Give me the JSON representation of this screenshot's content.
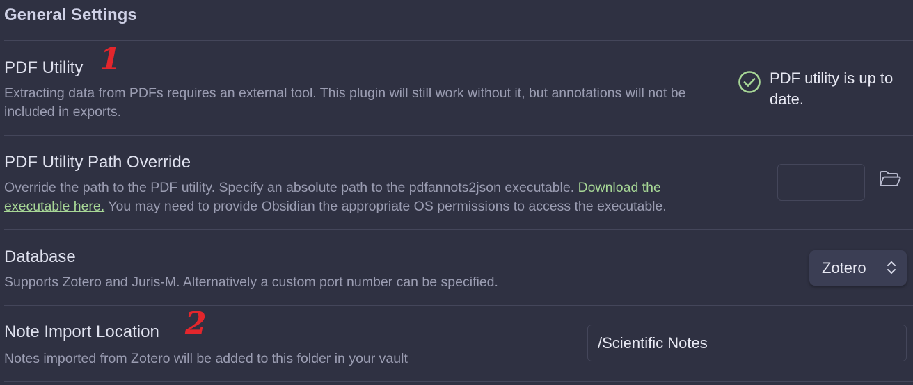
{
  "section": {
    "title": "General Settings"
  },
  "settings": [
    {
      "name": "PDF Utility",
      "marker": "1",
      "description": "Extracting data from PDFs requires an external tool. This plugin will still work without it, but annotations will not be included in exports.",
      "status": {
        "icon": "check-circle-icon",
        "text": "PDF utility is up to date.",
        "color": "#a7d796"
      }
    },
    {
      "name": "PDF Utility Path Override",
      "description_before": "Override the path to the PDF utility. Specify an absolute path to the pdfannots2json executable.",
      "link_text": "Download the executable here.",
      "description_after": "You may need to provide Obsidian the appropriate OS permissions to access the executable.",
      "input_value": "",
      "button_icon": "folder-open-icon"
    },
    {
      "name": "Database",
      "description": "Supports Zotero and Juris-M. Alternatively a custom port number can be specified.",
      "selected": "Zotero"
    },
    {
      "name": "Note Import Location",
      "marker": "2",
      "description": "Notes imported from Zotero will be added to this folder in your vault",
      "input_value": "/Scientific Notes"
    }
  ],
  "colors": {
    "background": "#2f3142",
    "link": "#a7d796",
    "annotation_marker": "#e3262c"
  }
}
